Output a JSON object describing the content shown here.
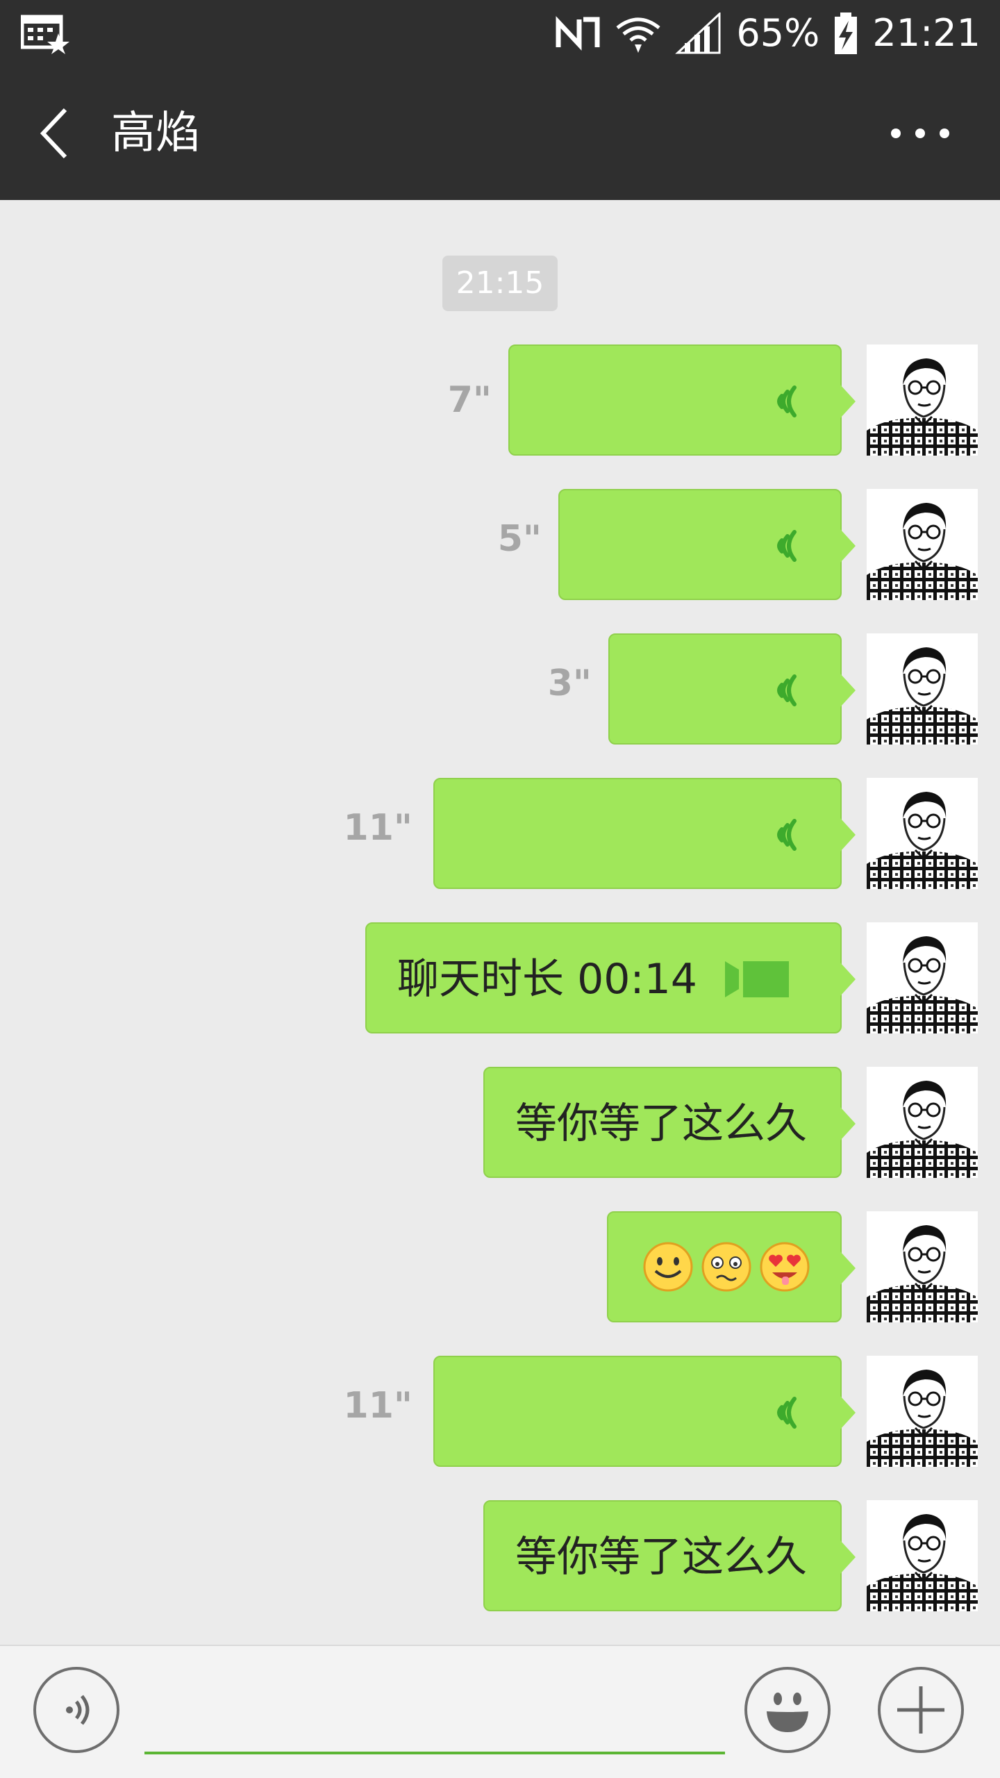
{
  "status_bar": {
    "battery_percent": "65%",
    "time": "21:21",
    "icons": [
      "calendar-star-icon",
      "nfc-icon",
      "wifi-icon",
      "signal-icon",
      "battery-charging-icon"
    ]
  },
  "header": {
    "title": "高焰",
    "back_icon": "chevron-left-icon",
    "more_icon": "more-dots-icon"
  },
  "chat": {
    "timestamp": "21:15",
    "messages": [
      {
        "type": "voice",
        "duration": "7\""
      },
      {
        "type": "voice",
        "duration": "5\""
      },
      {
        "type": "voice",
        "duration": "3\""
      },
      {
        "type": "voice",
        "duration": "11\""
      },
      {
        "type": "video_call",
        "text": "聊天时长 00:14"
      },
      {
        "type": "text",
        "text": "等你等了这么久"
      },
      {
        "type": "emoji",
        "emojis": [
          "smile-emoji",
          "awkward-emoji",
          "heart-eyes-emoji"
        ]
      },
      {
        "type": "voice",
        "duration": "11\""
      },
      {
        "type": "text",
        "text": "等你等了这么久"
      }
    ]
  },
  "input_bar": {
    "voice_icon": "voice-toggle-icon",
    "input_value": "",
    "emoji_icon": "emoji-icon",
    "plus_icon": "plus-icon"
  },
  "colors": {
    "bar": "#2f2f2f",
    "bubble": "#a0e75a",
    "background": "#ebebeb",
    "accent": "#5bb534"
  }
}
